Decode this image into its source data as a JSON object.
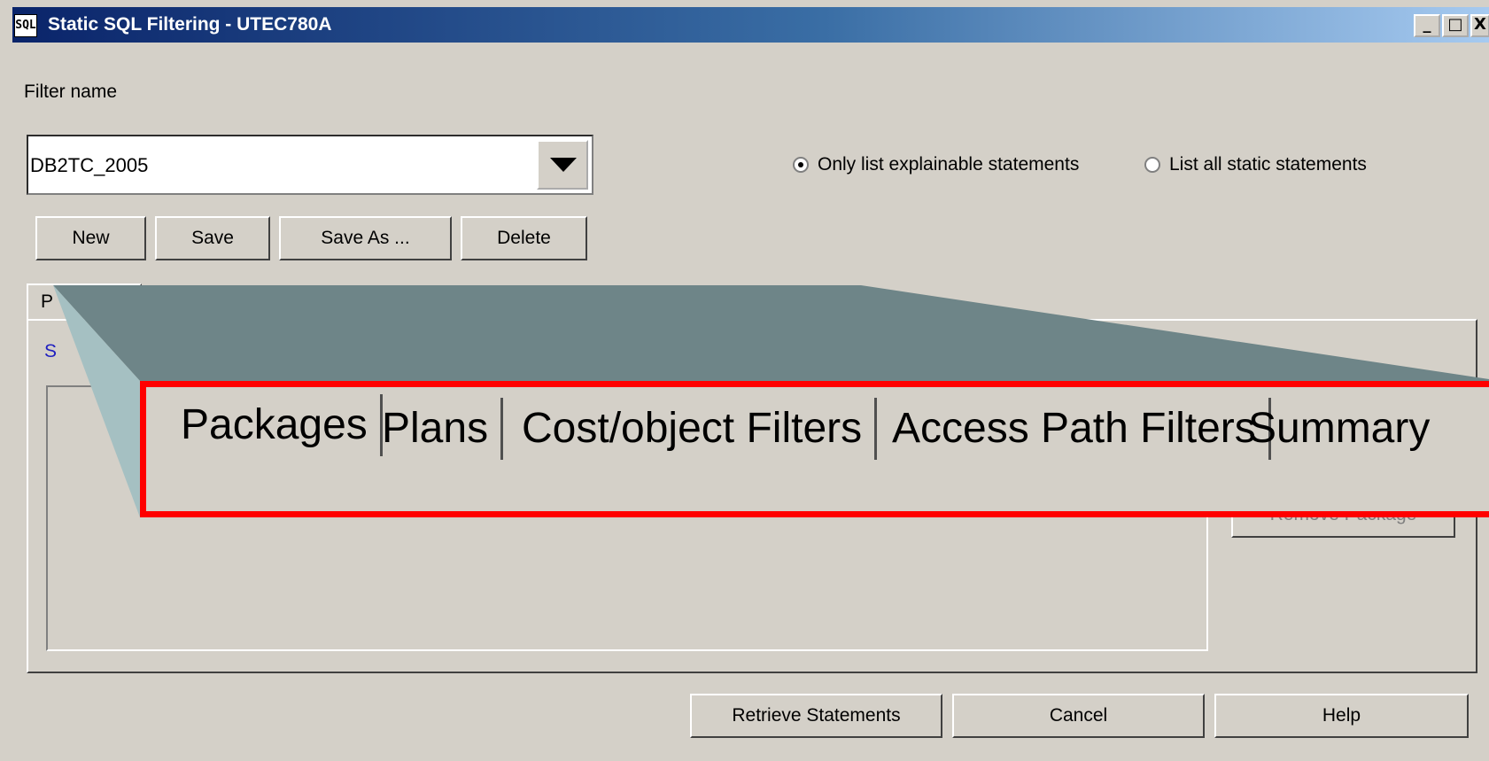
{
  "window": {
    "title": "Static SQL Filtering - UTEC780A",
    "app_icon_text": "SQL",
    "minimize_symbol": "_",
    "maximize_symbol": "□",
    "close_symbol": "X"
  },
  "filter": {
    "label": "Filter name",
    "value": "DB2TC_2005"
  },
  "options": {
    "explainable_label": "Only list explainable statements",
    "explainable_checked": true,
    "all_static_label": "List all static statements",
    "all_static_checked": false
  },
  "filter_buttons": {
    "new": "New",
    "save": "Save",
    "save_as": "Save As ...",
    "delete": "Delete"
  },
  "tabs_partial": {
    "first_letter": "P",
    "link_letter": "S"
  },
  "panel": {
    "remove_package_label": "Remove Package"
  },
  "zoom_tabs": [
    "Packages",
    "Plans",
    "Cost/object Filters",
    "Access Path Filters",
    "Summary"
  ],
  "bottom_buttons": {
    "retrieve": "Retrieve Statements",
    "cancel": "Cancel",
    "help": "Help"
  },
  "colors": {
    "highlight_border": "#ff0000",
    "zoom_band_top": "#6e8588",
    "zoom_band_side": "#a5c0c2"
  }
}
